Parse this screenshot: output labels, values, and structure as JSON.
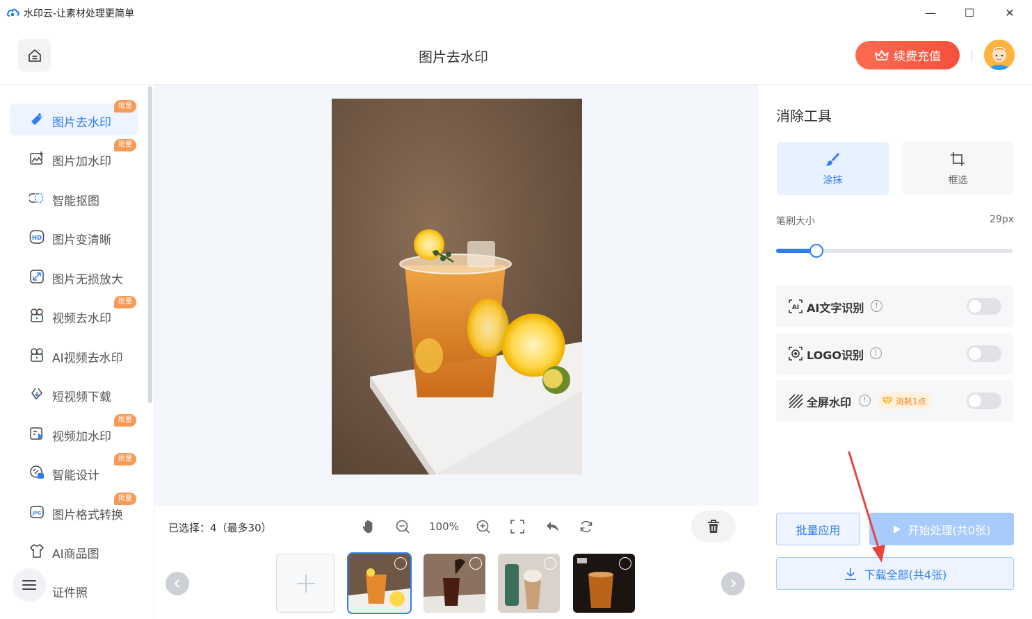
{
  "window": {
    "title": "水印云-让素材处理更简单",
    "minimize": "—",
    "maximize": "☐",
    "close": "✕"
  },
  "header": {
    "page_title": "图片去水印",
    "recharge_label": "续费充值"
  },
  "sidebar": {
    "items": [
      {
        "label": "图片去水印",
        "icon": "eraser-icon",
        "badge": "批量",
        "active": true
      },
      {
        "label": "图片加水印",
        "icon": "image-add-icon",
        "badge": "批量"
      },
      {
        "label": "智能抠图",
        "icon": "cutout-icon"
      },
      {
        "label": "图片变清晰",
        "icon": "hd-icon"
      },
      {
        "label": "图片无损放大",
        "icon": "enlarge-icon"
      },
      {
        "label": "视频去水印",
        "icon": "video-clean-icon",
        "badge": "批量"
      },
      {
        "label": "AI视频去水印",
        "icon": "ai-video-icon"
      },
      {
        "label": "短视频下载",
        "icon": "link-download-icon"
      },
      {
        "label": "视频加水印",
        "icon": "video-add-icon",
        "badge": "批量"
      },
      {
        "label": "智能设计",
        "icon": "design-icon",
        "badge": "批量"
      },
      {
        "label": "图片格式转换",
        "icon": "jpg-icon",
        "badge": "批量"
      },
      {
        "label": "AI商品图",
        "icon": "shirt-icon"
      },
      {
        "label": "证件照",
        "icon": "id-photo-icon"
      }
    ]
  },
  "toolbar": {
    "selected_info": "已选择：4（最多30）",
    "zoom": "100%"
  },
  "right_panel": {
    "title": "消除工具",
    "modes": [
      {
        "label": "涂抹",
        "icon": "brush-icon",
        "active": true
      },
      {
        "label": "框选",
        "icon": "crop-icon",
        "active": false
      }
    ],
    "brush_label": "笔刷大小",
    "brush_value": "29px",
    "brush_fraction": 0.17,
    "options": [
      {
        "label": "AI文字识别",
        "icon": "ai-text-icon",
        "enabled": false
      },
      {
        "label": "LOGO识别",
        "icon": "logo-detect-icon",
        "enabled": false
      },
      {
        "label": "全屏水印",
        "icon": "fullscreen-watermark-icon",
        "enabled": false,
        "cost": "消耗1点"
      }
    ],
    "batch_apply": "批量应用",
    "start_label": "开始处理(共0张)",
    "download_label": "下载全部(共4张)"
  },
  "colors": {
    "accent": "#2e7cf6",
    "recharge": "#f5503c",
    "badge": "#f79a55"
  }
}
